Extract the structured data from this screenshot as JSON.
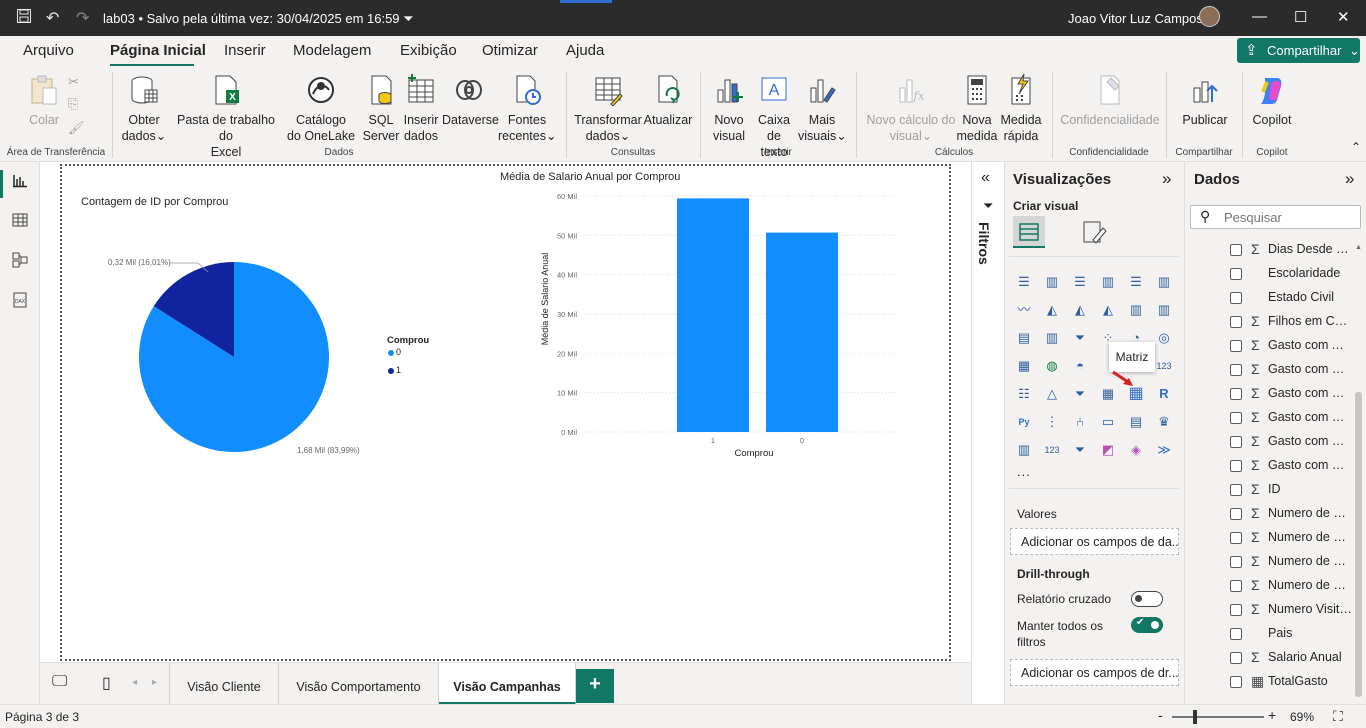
{
  "titlebar": {
    "file": "lab03",
    "saved": "•  Salvo pela última vez: 30/04/2025 em 16:59",
    "user": "Joao Vitor Luz Campos"
  },
  "menu": {
    "tabs": [
      "Arquivo",
      "Página Inicial",
      "Inserir",
      "Modelagem",
      "Exibição",
      "Otimizar",
      "Ajuda"
    ],
    "share": "Compartilhar"
  },
  "ribbon": {
    "colar": "Colar",
    "obter": [
      "Obter",
      "dados"
    ],
    "pasta": [
      "Pasta de trabalho do",
      "Excel"
    ],
    "catalogo": [
      "Catálogo",
      "do OneLake"
    ],
    "sql": [
      "SQL",
      "Server"
    ],
    "inserir_dados": [
      "Inserir",
      "dados"
    ],
    "dataverse": "Dataverse",
    "fontes": [
      "Fontes",
      "recentes"
    ],
    "transformar": [
      "Transformar",
      "dados"
    ],
    "atualizar": "Atualizar",
    "novo_visual": [
      "Novo",
      "visual"
    ],
    "caixa": [
      "Caixa de",
      "texto"
    ],
    "mais": [
      "Mais",
      "visuais"
    ],
    "novo_calc": [
      "Novo cálculo do",
      "visual"
    ],
    "nova_medida": [
      "Nova",
      "medida"
    ],
    "medida_rapida": [
      "Medida",
      "rápida"
    ],
    "confidencialidade": "Confidencialidade",
    "publicar": "Publicar",
    "copilot": "Copilot",
    "groups": [
      "Área de Transferência",
      "Dados",
      "Consultas",
      "Inserir",
      "Cálculos",
      "Confidencialidade",
      "Compartilhar",
      "Copilot"
    ]
  },
  "pie": {
    "title": "Contagem de ID por Comprou",
    "label1": "0,32 Mil (16,01%)",
    "label0": "1,68 Mil (83,99%)",
    "legend_title": "Comprou",
    "legend": [
      "0",
      "1"
    ]
  },
  "bar": {
    "title": "Média de Salario Anual por Comprou",
    "ylabel": "Média de Salario Anual",
    "xlabel": "Comprou"
  },
  "chart_data": [
    {
      "type": "pie",
      "title": "Contagem de ID por Comprou",
      "categories": [
        "0",
        "1"
      ],
      "values": [
        1680,
        320
      ],
      "percent": [
        83.99,
        16.01
      ],
      "colors": [
        "#118dff",
        "#12239e"
      ],
      "legend_title": "Comprou",
      "legend_position": "right"
    },
    {
      "type": "bar",
      "title": "Média de Salario Anual por Comprou",
      "categories": [
        "1",
        "0"
      ],
      "values": [
        59400,
        50700
      ],
      "xlabel": "Comprou",
      "ylabel": "Média de Salario Anual",
      "ylim": [
        0,
        60000
      ],
      "yticks": [
        "0 Mil",
        "10 Mil",
        "20 Mil",
        "30 Mil",
        "40 Mil",
        "50 Mil",
        "60 Mil"
      ],
      "grid": true,
      "color": "#118dff"
    }
  ],
  "pages": {
    "tabs": [
      "Visão Cliente",
      "Visão Comportamento",
      "Visão Campanhas"
    ],
    "add": "+"
  },
  "status": {
    "page": "Página 3 de 3",
    "zoom": "69%",
    "minus": "-",
    "plus": "+"
  },
  "filters": {
    "label": "Filtros"
  },
  "viz": {
    "title": "Visualizações",
    "criar": "Criar visual",
    "tooltip": "Matriz",
    "valores": "Valores",
    "valores_well": "Adicionar os campos de da...",
    "drill": "Drill-through",
    "relatorio": "Relatório cruzado",
    "relatorio_state": "Desativado",
    "manter": [
      "Manter todos os",
      "filtros"
    ],
    "manter_state": "Ativado",
    "drill_well": "Adicionar os campos de dr...",
    "more": "..."
  },
  "data_pane": {
    "title": "Dados",
    "search": "Pesquisar",
    "fields": [
      {
        "name": "Dias Desde Ul...",
        "sigma": true
      },
      {
        "name": "Escolaridade",
        "sigma": false
      },
      {
        "name": "Estado Civil",
        "sigma": false
      },
      {
        "name": "Filhos em Casa",
        "sigma": true
      },
      {
        "name": "Gasto com Ali...",
        "sigma": true
      },
      {
        "name": "Gasto com Bri...",
        "sigma": true
      },
      {
        "name": "Gasto com Ele...",
        "sigma": true
      },
      {
        "name": "Gasto com M...",
        "sigma": true
      },
      {
        "name": "Gasto com Uti...",
        "sigma": true
      },
      {
        "name": "Gasto com Ve...",
        "sigma": true
      },
      {
        "name": "ID",
        "sigma": true
      },
      {
        "name": "Numero de C...",
        "sigma": true
      },
      {
        "name": "Numero de C...",
        "sigma": true
      },
      {
        "name": "Numero de C...",
        "sigma": true
      },
      {
        "name": "Numero de C...",
        "sigma": true
      },
      {
        "name": "Numero Visita...",
        "sigma": true
      },
      {
        "name": "Pais",
        "sigma": false
      },
      {
        "name": "Salario Anual",
        "sigma": true
      },
      {
        "name": "TotalGasto",
        "sigma": false,
        "calc": true
      }
    ]
  },
  "colors": {
    "accent": "#117865",
    "pie_dark": "#12239e",
    "pie_light": "#118dff",
    "titlebar": "#2b2b2b"
  }
}
